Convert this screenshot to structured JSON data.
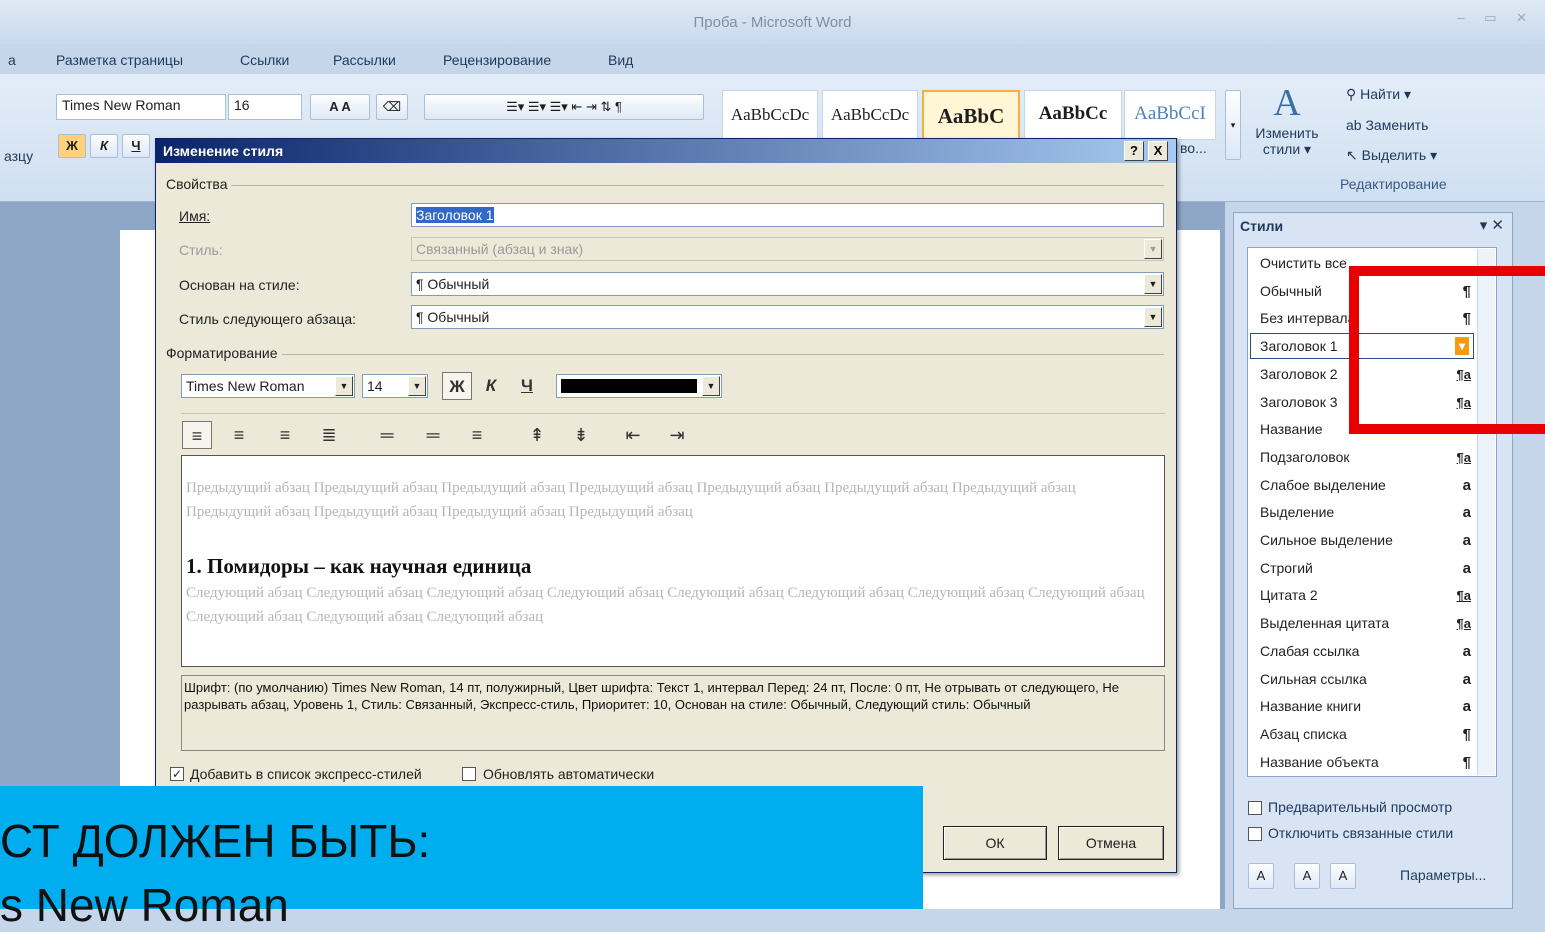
{
  "window": {
    "title": "Проба - Microsoft Word",
    "controls": "– ▭ ✕"
  },
  "menu": {
    "items": [
      "а",
      "Разметка страницы",
      "Ссылки",
      "Рассылки",
      "Рецензирование",
      "Вид"
    ]
  },
  "ribbon": {
    "font_name": "Times New Roman",
    "font_size": "16",
    "bold_label": "Ж",
    "italic_label": "К",
    "underline_label": "Ч",
    "left_fragment": "азцу",
    "style_tiles": [
      "AaBbCcDc",
      "AaBbCcDc",
      "AaBbC",
      "AaBbCc",
      "AaBbCcI"
    ],
    "more_fragment": "во...",
    "change_styles": "Изменить стили ▾",
    "find": "Найти ▾",
    "replace": "Заменить",
    "select": "Выделить ▾",
    "editing_group": "Редактирование"
  },
  "dialog": {
    "title": "Изменение стиля",
    "help": "?",
    "close": "X",
    "properties_group": "Свойства",
    "name_label": "Имя:",
    "name_value": "Заголовок 1",
    "style_label": "Стиль:",
    "style_value": "Связанный (абзац и знак)",
    "based_on_label": "Основан на стиле:",
    "based_on_value": "¶ Обычный",
    "next_style_label": "Стиль следующего абзаца:",
    "next_style_value": "¶ Обычный",
    "formatting_group": "Форматирование",
    "font_name": "Times New Roman",
    "font_size": "14",
    "bold": "Ж",
    "italic": "К",
    "underline": "Ч",
    "preview_prev": "Предыдущий абзац Предыдущий абзац Предыдущий абзац Предыдущий абзац Предыдущий абзац Предыдущий абзац Предыдущий абзац Предыдущий абзац Предыдущий абзац Предыдущий абзац Предыдущий абзац",
    "preview_heading": "1. Помидоры – как научная единица",
    "preview_next": "Следующий абзац Следующий абзац Следующий абзац Следующий абзац Следующий абзац Следующий абзац Следующий абзац Следующий абзац Следующий абзац Следующий абзац Следующий абзац",
    "description": "Шрифт: (по умолчанию) Times New Roman, 14 пт, полужирный, Цвет шрифта: Текст 1, интервал Перед:  24 пт, После:  0 пт, Не отрывать от следующего, Не разрывать абзац, Уровень 1, Стиль: Связанный, Экспресс-стиль, Приоритет: 10, Основан на стиле: Обычный, Следующий стиль: Обычный",
    "add_quick_styles": "Добавить в список экспресс-стилей",
    "auto_update": "Обновлять автоматически",
    "ok": "ОК",
    "cancel": "Отмена"
  },
  "styles_pane": {
    "title": "Стили",
    "items": [
      {
        "name": "Очистить все",
        "icon": ""
      },
      {
        "name": "Обычный",
        "icon": "¶"
      },
      {
        "name": "Без интервала",
        "icon": "¶"
      },
      {
        "name": "Заголовок 1",
        "icon": "▾"
      },
      {
        "name": "Заголовок 2",
        "icon": "¶a"
      },
      {
        "name": "Заголовок 3",
        "icon": "¶a"
      },
      {
        "name": "Название",
        "icon": ""
      },
      {
        "name": "Подзаголовок",
        "icon": "¶a"
      },
      {
        "name": "Слабое выделение",
        "icon": "a"
      },
      {
        "name": "Выделение",
        "icon": "a"
      },
      {
        "name": "Сильное выделение",
        "icon": "a"
      },
      {
        "name": "Строгий",
        "icon": "a"
      },
      {
        "name": "Цитата 2",
        "icon": "¶a"
      },
      {
        "name": "Выделенная цитата",
        "icon": "¶a"
      },
      {
        "name": "Слабая ссылка",
        "icon": "a"
      },
      {
        "name": "Сильная ссылка",
        "icon": "a"
      },
      {
        "name": "Название книги",
        "icon": "a"
      },
      {
        "name": "Абзац списка",
        "icon": "¶"
      },
      {
        "name": "Название объекта",
        "icon": "¶"
      }
    ],
    "preview_option": "Предварительный просмотр",
    "disable_linked": "Отключить связанные стили",
    "params": "Параметры..."
  },
  "banner": {
    "line1": "СТ ДОЛЖЕН БЫТЬ:",
    "line2": "s New Roman"
  },
  "colors": {
    "highlight": "#e80000",
    "banner": "#00adef"
  }
}
